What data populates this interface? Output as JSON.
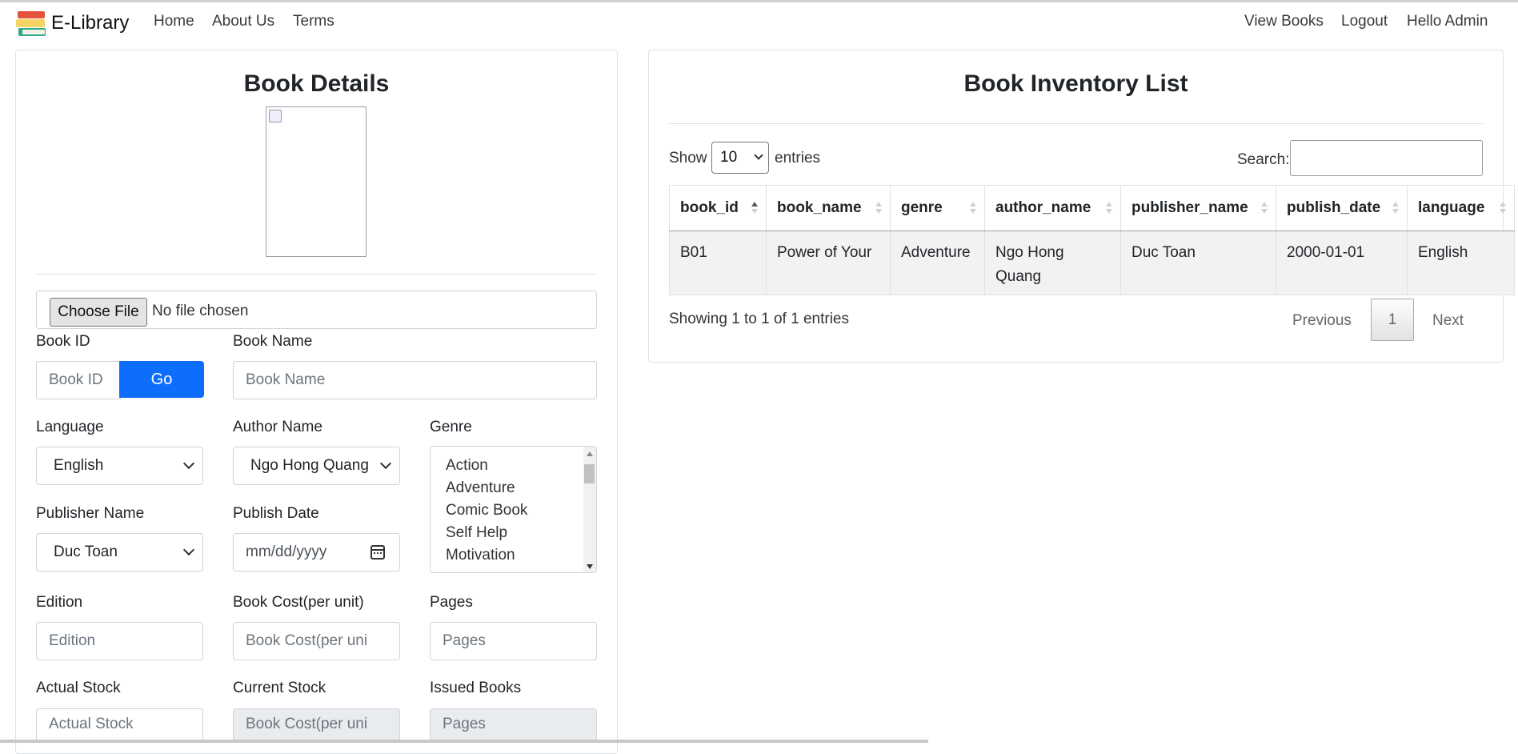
{
  "navbar": {
    "brand": "E-Library",
    "links": {
      "home": "Home",
      "about": "About Us",
      "terms": "Terms"
    },
    "right": {
      "view_books": "View Books",
      "logout": "Logout",
      "hello": "Hello Admin"
    }
  },
  "details": {
    "title": "Book Details",
    "file_button": "Choose File",
    "file_status": "No file chosen",
    "book_id": {
      "label": "Book ID",
      "placeholder": "Book ID",
      "go": "Go"
    },
    "book_name": {
      "label": "Book Name",
      "placeholder": "Book Name"
    },
    "language": {
      "label": "Language",
      "value": "English"
    },
    "author": {
      "label": "Author Name",
      "value": "Ngo Hong Quang"
    },
    "genre": {
      "label": "Genre",
      "options": [
        "Action",
        "Adventure",
        "Comic Book",
        "Self Help",
        "Motivation"
      ]
    },
    "publisher": {
      "label": "Publisher Name",
      "value": "Duc Toan"
    },
    "publish_date": {
      "label": "Publish Date",
      "placeholder": "mm/dd/yyyy"
    },
    "edition": {
      "label": "Edition",
      "placeholder": "Edition"
    },
    "book_cost": {
      "label": "Book Cost(per unit)",
      "placeholder": "Book Cost(per uni"
    },
    "pages": {
      "label": "Pages",
      "placeholder": "Pages"
    },
    "actual_stock": {
      "label": "Actual Stock",
      "placeholder": "Actual Stock"
    },
    "current_stock": {
      "label": "Current Stock",
      "placeholder": "Book Cost(per uni"
    },
    "issued_books": {
      "label": "Issued Books",
      "placeholder": "Pages"
    }
  },
  "inventory": {
    "title": "Book Inventory List",
    "show": "Show",
    "entries": "entries",
    "length_value": "10",
    "search_label": "Search:",
    "columns": [
      "book_id",
      "book_name",
      "genre",
      "author_name",
      "publisher_name",
      "publish_date",
      "language"
    ],
    "rows": [
      [
        "B01",
        "Power of Your",
        "Adventure",
        "Ngo Hong Quang",
        "Duc Toan",
        "2000-01-01",
        "English"
      ]
    ],
    "info": "Showing 1 to 1 of 1 entries",
    "pagination": {
      "previous": "Previous",
      "current": "1",
      "next": "Next"
    }
  }
}
